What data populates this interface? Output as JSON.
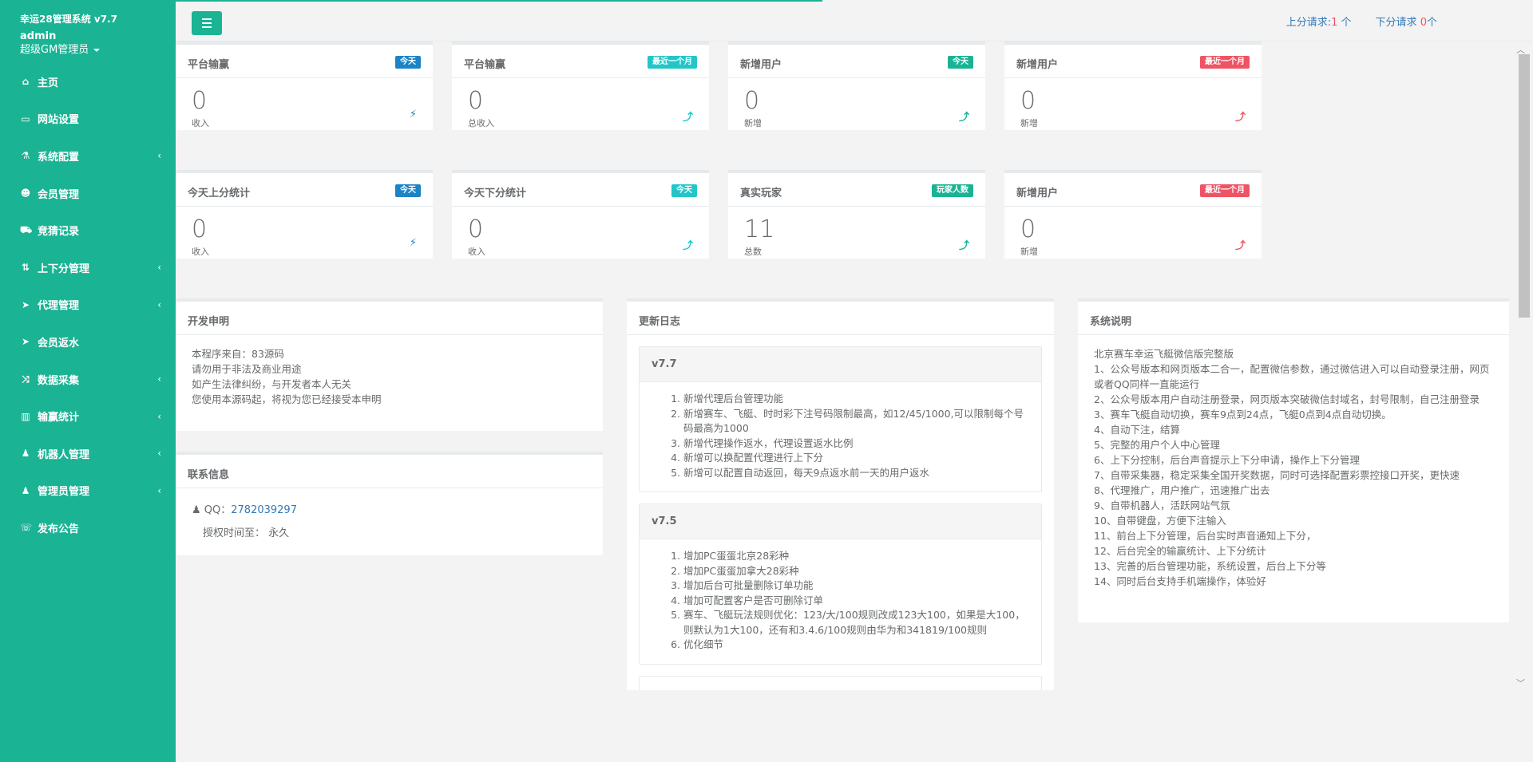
{
  "brand": {
    "title": "幸运28管理系统 v7.7",
    "user": "admin",
    "role": "超级GM管理员"
  },
  "nav": [
    {
      "icon": "⌂",
      "name": "home-icon",
      "label": "主页",
      "chevron": ""
    },
    {
      "icon": "▭",
      "name": "book-icon",
      "label": "网站设置",
      "chevron": ""
    },
    {
      "icon": "⚗",
      "name": "flask-icon",
      "label": "系统配置",
      "chevron": "‹"
    },
    {
      "icon": "☻",
      "name": "user-icon",
      "label": "会员管理",
      "chevron": ""
    },
    {
      "icon": "⛟",
      "name": "car-icon",
      "label": "竞猜记录",
      "chevron": ""
    },
    {
      "icon": "⇅",
      "name": "transfer-icon",
      "label": "上下分管理",
      "chevron": "‹"
    },
    {
      "icon": "➤",
      "name": "send-icon",
      "label": "代理管理",
      "chevron": "‹"
    },
    {
      "icon": "➤",
      "name": "send-icon",
      "label": "会员返水",
      "chevron": ""
    },
    {
      "icon": "⤨",
      "name": "shuffle-icon",
      "label": "数据采集",
      "chevron": "‹"
    },
    {
      "icon": "▥",
      "name": "bar-chart-icon",
      "label": "输赢统计",
      "chevron": "‹"
    },
    {
      "icon": "♟",
      "name": "robot-icon",
      "label": "机器人管理",
      "chevron": "‹"
    },
    {
      "icon": "♟",
      "name": "admin-icon",
      "label": "管理员管理",
      "chevron": "‹"
    },
    {
      "icon": "☏",
      "name": "comment-icon",
      "label": "发布公告",
      "chevron": ""
    }
  ],
  "topbar": {
    "up_label": "上分请求:",
    "up_count": "1",
    "up_unit": "个",
    "down_label": "下分请求",
    "down_count": "0",
    "down_unit": "个"
  },
  "stats_row1": [
    {
      "title": "平台输赢",
      "badge": "今天",
      "badge_color": "#1c84c6",
      "value": "0",
      "sub": "收入",
      "icon": "⚡",
      "icon_color": "#1c84c6"
    },
    {
      "title": "平台输赢",
      "badge": "最近一个月",
      "badge_color": "#23c6c8",
      "value": "0",
      "sub": "总收入",
      "icon": "⤴",
      "icon_color": "#23c6c8"
    },
    {
      "title": "新增用户",
      "badge": "今天",
      "badge_color": "#1ab394",
      "value": "0",
      "sub": "新增",
      "icon": "⤴",
      "icon_color": "#1ab394"
    },
    {
      "title": "新增用户",
      "badge": "最近一个月",
      "badge_color": "#ed5565",
      "value": "0",
      "sub": "新增",
      "icon": "⤴",
      "icon_color": "#ed5565"
    }
  ],
  "stats_row2": [
    {
      "title": "今天上分统计",
      "badge": "今天",
      "badge_color": "#1c84c6",
      "value": "0",
      "sub": "收入",
      "icon": "⚡",
      "icon_color": "#1c84c6"
    },
    {
      "title": "今天下分统计",
      "badge": "今天",
      "badge_color": "#23c6c8",
      "value": "0",
      "sub": "收入",
      "icon": "⤴",
      "icon_color": "#23c6c8"
    },
    {
      "title": "真实玩家",
      "badge": "玩家人数",
      "badge_color": "#1ab394",
      "value": "11",
      "sub": "总数",
      "icon": "⤴",
      "icon_color": "#1ab394"
    },
    {
      "title": "新增用户",
      "badge": "最近一个月",
      "badge_color": "#ed5565",
      "value": "0",
      "sub": "新增",
      "icon": "⤴",
      "icon_color": "#ed5565"
    }
  ],
  "dev_notice": {
    "title": "开发申明",
    "lines": [
      "本程序来自：83源码",
      "请勿用于非法及商业用途",
      "如产生法律纠纷，与开发者本人无关",
      "您使用本源码起，将视为您已经接受本申明"
    ]
  },
  "contact": {
    "title": "联系信息",
    "qq_label": "QQ：",
    "qq": "2782039297",
    "auth_label": "授权时间至：",
    "auth_value": "永久"
  },
  "changelog": {
    "title": "更新日志",
    "versions": [
      {
        "version": "v7.7",
        "items": [
          "新增代理后台管理功能",
          "新增赛车、飞艇、时时彩下注号码限制最高，如12/45/1000,可以限制每个号码最高为1000",
          "新增代理操作返水，代理设置返水比例",
          "新增可以换配置代理进行上下分",
          "新增可以配置自动返回，每天9点返水前一天的用户返水"
        ]
      },
      {
        "version": "v7.5",
        "items": [
          "增加PC蛋蛋北京28彩种",
          "增加PC蛋蛋加拿大28彩种",
          "增加后台可批量删除订单功能",
          "增加可配置客户是否可删除订单",
          "赛车、飞艇玩法规则优化：123/大/100规则改成123大100，如果是大100，则默认为1大100，还有和3.4.6/100规则由华为和341819/100规则",
          "优化细节"
        ]
      }
    ]
  },
  "sys_desc": {
    "title": "系统说明",
    "lines": [
      "北京赛车幸运飞艇微信版完整版",
      "1、公众号版本和网页版本二合一，配置微信参数，通过微信进入可以自动登录注册，网页或者QQ同样一直能运行",
      "2、公众号版本用户自动注册登录，网页版本突破微信封域名，封号限制，自己注册登录",
      "3、赛车飞艇自动切换，赛车9点到24点，飞艇0点到4点自动切换。",
      "4、自动下注，结算",
      "5、完整的用户个人中心管理",
      "6、上下分控制，后台声音提示上下分申请，操作上下分管理",
      "7、自带采集器，稳定采集全国开奖数据，同时可选择配置彩票控接口开奖，更快速",
      "8、代理推广，用户推广，迅速推广出去",
      "9、自带机器人，活跃网站气氛",
      "10、自带键盘，方便下注输入",
      "11、前台上下分管理，后台实时声音通知上下分，",
      "12、后台完全的输赢统计、上下分统计",
      "13、完善的后台管理功能，系统设置，后台上下分等",
      "14、同时后台支持手机端操作，体验好"
    ]
  }
}
